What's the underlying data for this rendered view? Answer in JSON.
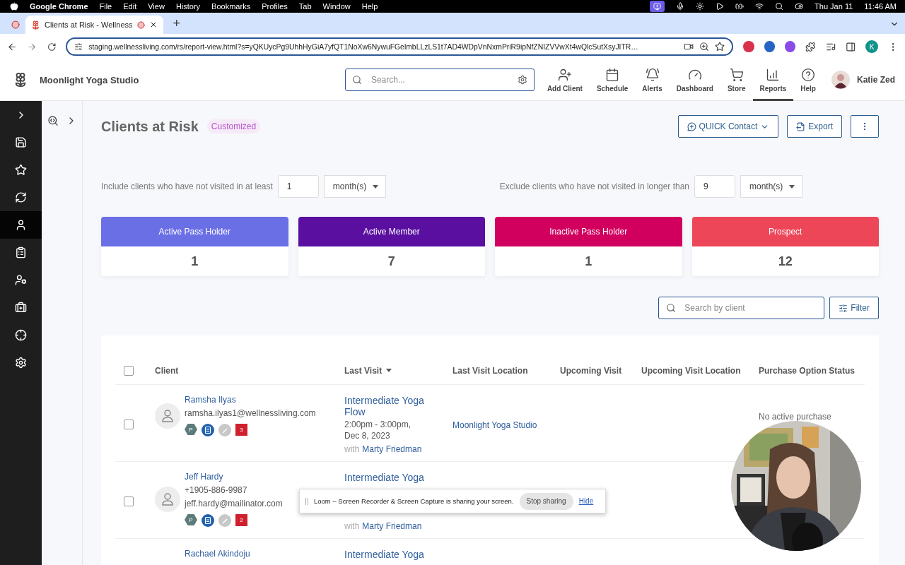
{
  "menubar": {
    "app": "Google Chrome",
    "menus": [
      "File",
      "Edit",
      "View",
      "History",
      "Bookmarks",
      "Profiles",
      "Tab",
      "Window",
      "Help"
    ],
    "date": "Thu Jan 11",
    "time": "11:46 AM"
  },
  "browser": {
    "tab": {
      "title": "Clients at Risk - Wellness",
      "selected": true
    },
    "new_tab": "+",
    "url": "staging.wellnessliving.com/rs/report-view.html?s=yQKUycPg9UhhHyGiA7yfQT1NoXw6NywuFGelmbLLzLS1t7AD4WDpVnNxmPriR9ipNfZNIZVVwXt4wQlcSutXsyJITR…",
    "profile_initial": "K"
  },
  "header": {
    "studio": "Moonlight Yoga Studio",
    "search": {
      "placeholder": "Search..."
    },
    "nav": [
      {
        "label": "Add Client",
        "selected": false
      },
      {
        "label": "Schedule",
        "selected": false
      },
      {
        "label": "Alerts",
        "selected": false
      },
      {
        "label": "Dashboard",
        "selected": false
      },
      {
        "label": "Store",
        "selected": false
      },
      {
        "label": "Reports",
        "selected": true
      },
      {
        "label": "Help",
        "selected": false
      }
    ],
    "user": "Katie Zed"
  },
  "sidebar": {
    "items": [
      {
        "selected": false
      },
      {
        "selected": false
      },
      {
        "selected": false
      },
      {
        "selected": true
      },
      {
        "selected": false
      },
      {
        "selected": false
      },
      {
        "selected": false
      },
      {
        "selected": false
      },
      {
        "selected": false
      }
    ]
  },
  "page": {
    "title": "Clients at Risk",
    "badge": "Customized",
    "actions": [
      {
        "kind": "dropdown",
        "label": "QUICK Contact"
      },
      {
        "kind": "export",
        "label": "Export"
      },
      {
        "kind": "more"
      }
    ],
    "include": {
      "label": "Include clients who have not visited in at least",
      "value": "1",
      "unit": "month(s)"
    },
    "exclude": {
      "label": "Exclude clients who have not visited in longer than",
      "value": "9",
      "unit": "month(s)"
    },
    "cards": [
      {
        "label": "Active Pass Holder",
        "count": "1",
        "color": "#6b6fe6"
      },
      {
        "label": "Active Member",
        "count": "7",
        "color": "#5a0fa0"
      },
      {
        "label": "Inactive Pass Holder",
        "count": "1",
        "color": "#d1005f"
      },
      {
        "label": "Prospect",
        "count": "12",
        "color": "#ec4658"
      }
    ],
    "client_search": {
      "placeholder": "Search by client"
    },
    "filter_button": "Filter"
  },
  "table": {
    "select_all": {
      "checked": false
    },
    "columns": [
      {
        "label": "Client",
        "sorted": false
      },
      {
        "label": "Last Visit",
        "sorted": true
      },
      {
        "label": "Last Visit Location",
        "sorted": false
      },
      {
        "label": "Upcoming Visit",
        "sorted": false
      },
      {
        "label": "Upcoming Visit Location",
        "sorted": false
      },
      {
        "label": "Purchase Option Status",
        "sorted": false
      }
    ],
    "rows": [
      {
        "checked": false,
        "name": "Ramsha Ilyas",
        "contacts": [
          "ramsha.ilyas1@wellnessliving.com"
        ],
        "tags": [
          {
            "kind": "pass",
            "text": "P"
          },
          {
            "kind": "doc"
          },
          {
            "kind": "note"
          },
          {
            "kind": "count",
            "text": "3"
          }
        ],
        "visit": {
          "class": "Intermediate Yoga Flow",
          "time": "2:00pm - 3:00pm, Dec 8, 2023",
          "with": "with",
          "instructor": "Marty Friedman"
        },
        "location": "Moonlight Yoga Studio",
        "status": "No active purchase"
      },
      {
        "checked": false,
        "name": "Jeff Hardy",
        "contacts": [
          "+1905-886-9987",
          "jeff.hardy@mailinator.com"
        ],
        "tags": [
          {
            "kind": "pass",
            "text": "P"
          },
          {
            "kind": "doc"
          },
          {
            "kind": "note"
          },
          {
            "kind": "count",
            "text": "2"
          }
        ],
        "visit": {
          "class": "Intermediate Yoga",
          "with": "with",
          "instructor": "Marty Friedman"
        }
      },
      {
        "name": "Rachael Akindoju",
        "visit": {
          "class": "Intermediate Yoga"
        }
      }
    ]
  },
  "loom": {
    "message": "Loom – Screen Recorder & Screen Capture is sharing your screen.",
    "stop": "Stop sharing",
    "hide": "Hide"
  }
}
